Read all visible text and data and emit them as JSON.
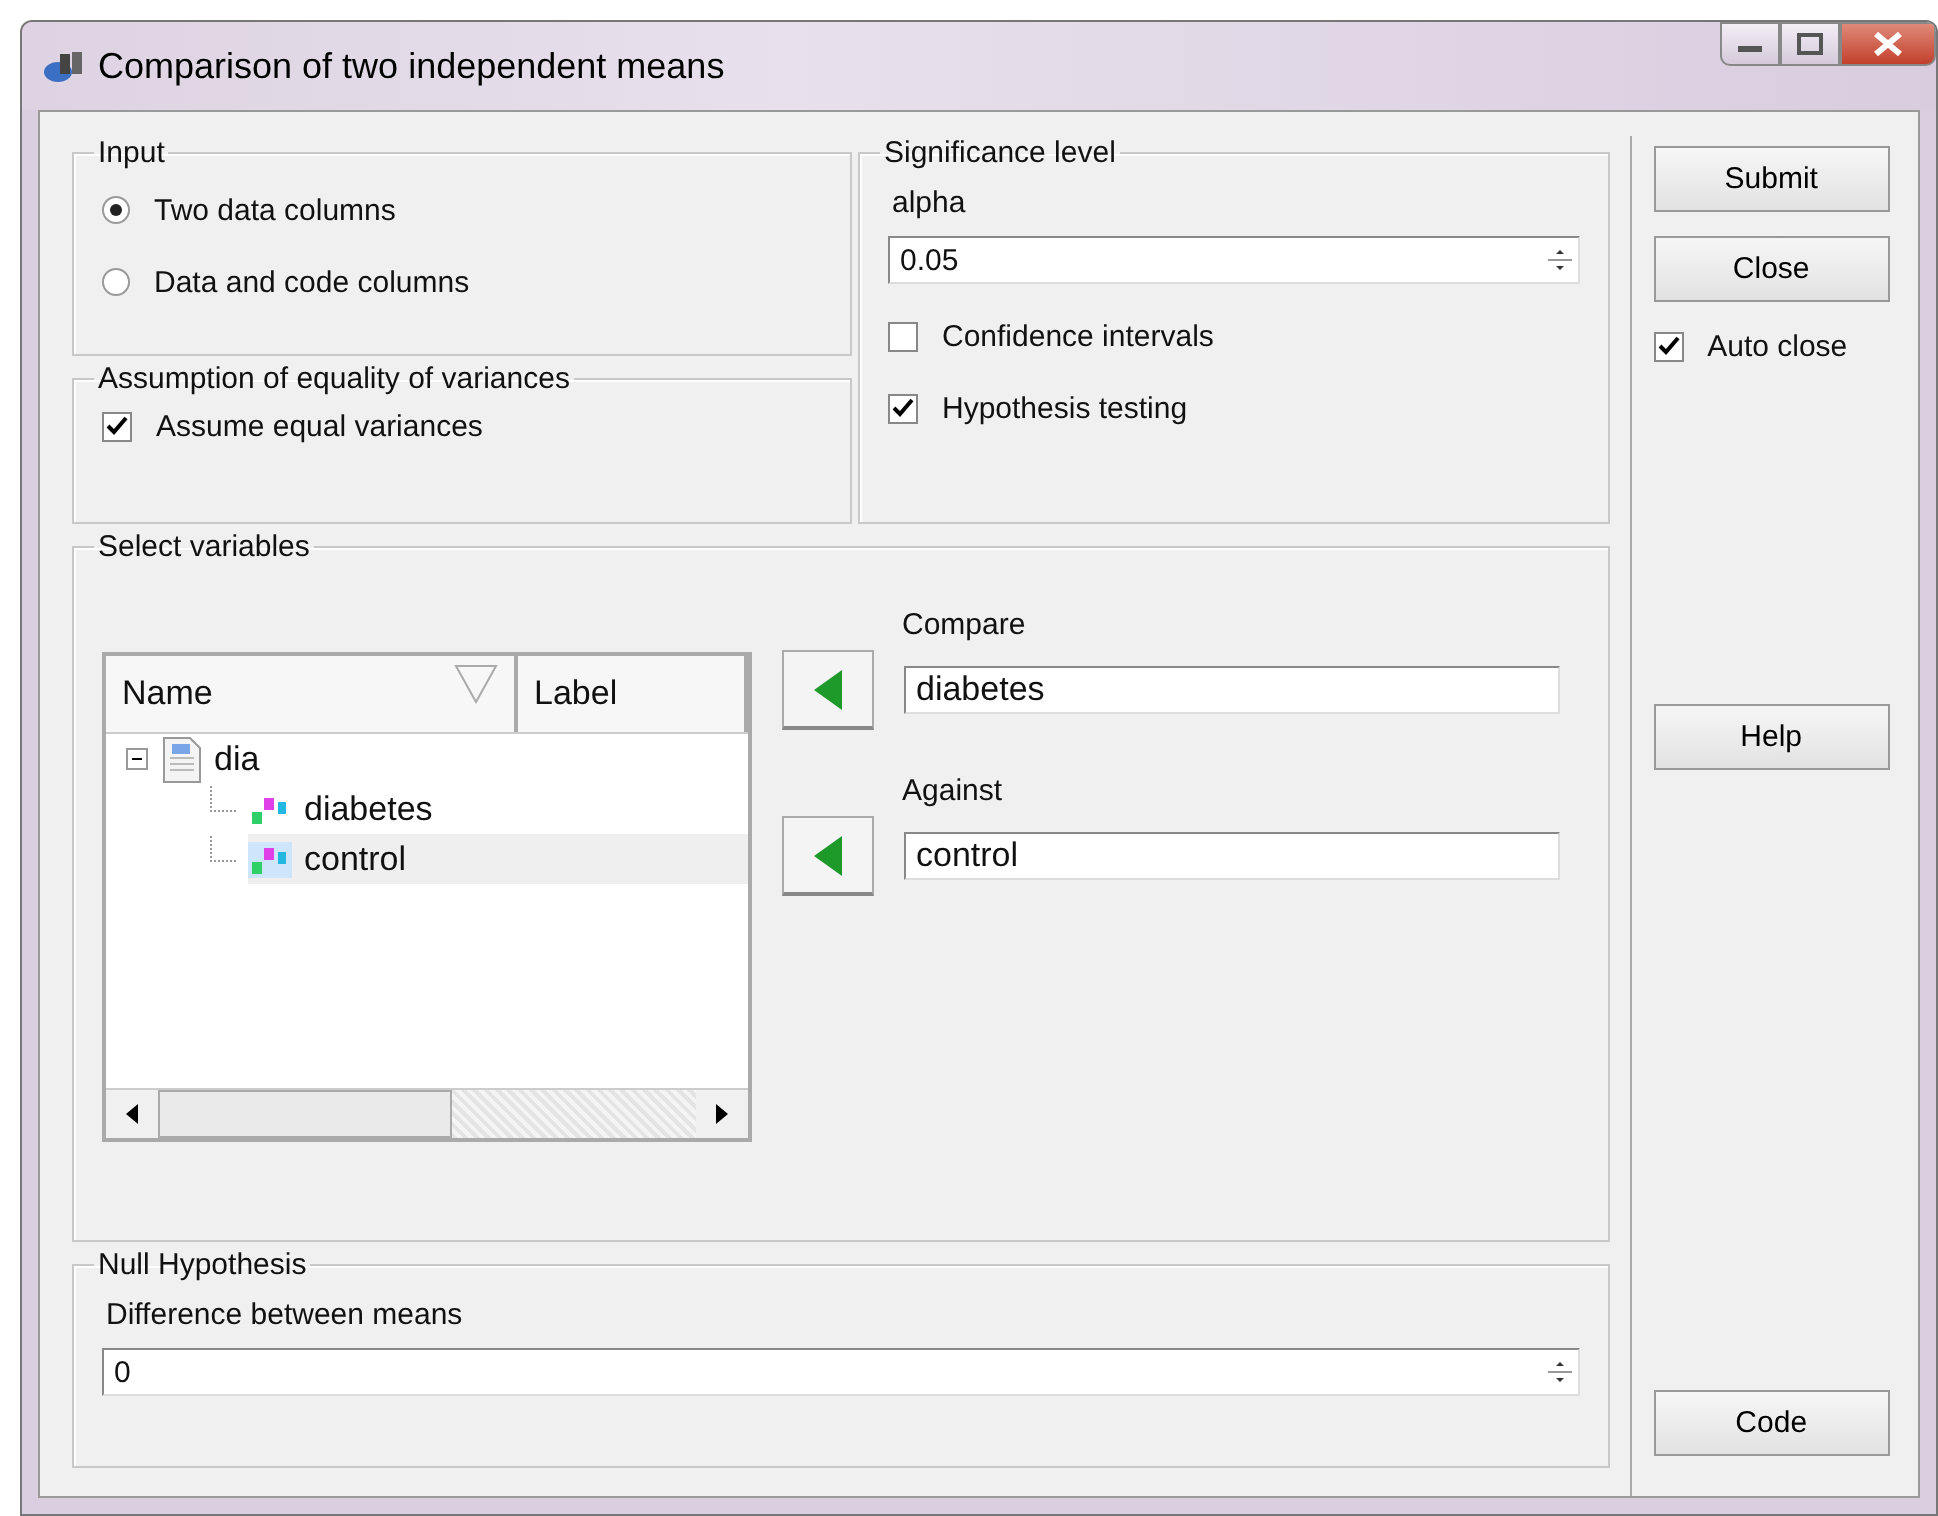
{
  "window": {
    "title": "Comparison of two independent means"
  },
  "input": {
    "title": "Input",
    "options": [
      {
        "label": "Two data columns",
        "selected": true
      },
      {
        "label": "Data and code columns",
        "selected": false
      }
    ]
  },
  "variances": {
    "title": "Assumption of equality of variances",
    "checkbox": {
      "label": "Assume equal variances",
      "checked": true
    }
  },
  "significance": {
    "title": "Significance level",
    "alpha_label": "alpha",
    "alpha_value": "0.05",
    "checkboxes": [
      {
        "label": "Confidence intervals",
        "checked": false
      },
      {
        "label": "Hypothesis testing",
        "checked": true
      }
    ]
  },
  "variables": {
    "title": "Select variables",
    "columns": [
      "Name",
      "Label"
    ],
    "tree": [
      {
        "label": "dia",
        "kind": "dataset",
        "expanded": true,
        "selected": false,
        "children": [
          {
            "label": "diabetes",
            "kind": "variable",
            "selected": false
          },
          {
            "label": "control",
            "kind": "variable",
            "selected": true
          }
        ]
      }
    ],
    "targets": [
      {
        "label": "Compare",
        "value": "diabetes"
      },
      {
        "label": "Against",
        "value": "control"
      }
    ]
  },
  "null_hypothesis": {
    "title": "Null Hypothesis",
    "label": "Difference between means",
    "value": "0"
  },
  "buttons": {
    "submit": "Submit",
    "close": "Close",
    "help": "Help",
    "code": "Code"
  },
  "auto_close": {
    "label": "Auto close",
    "checked": true
  }
}
